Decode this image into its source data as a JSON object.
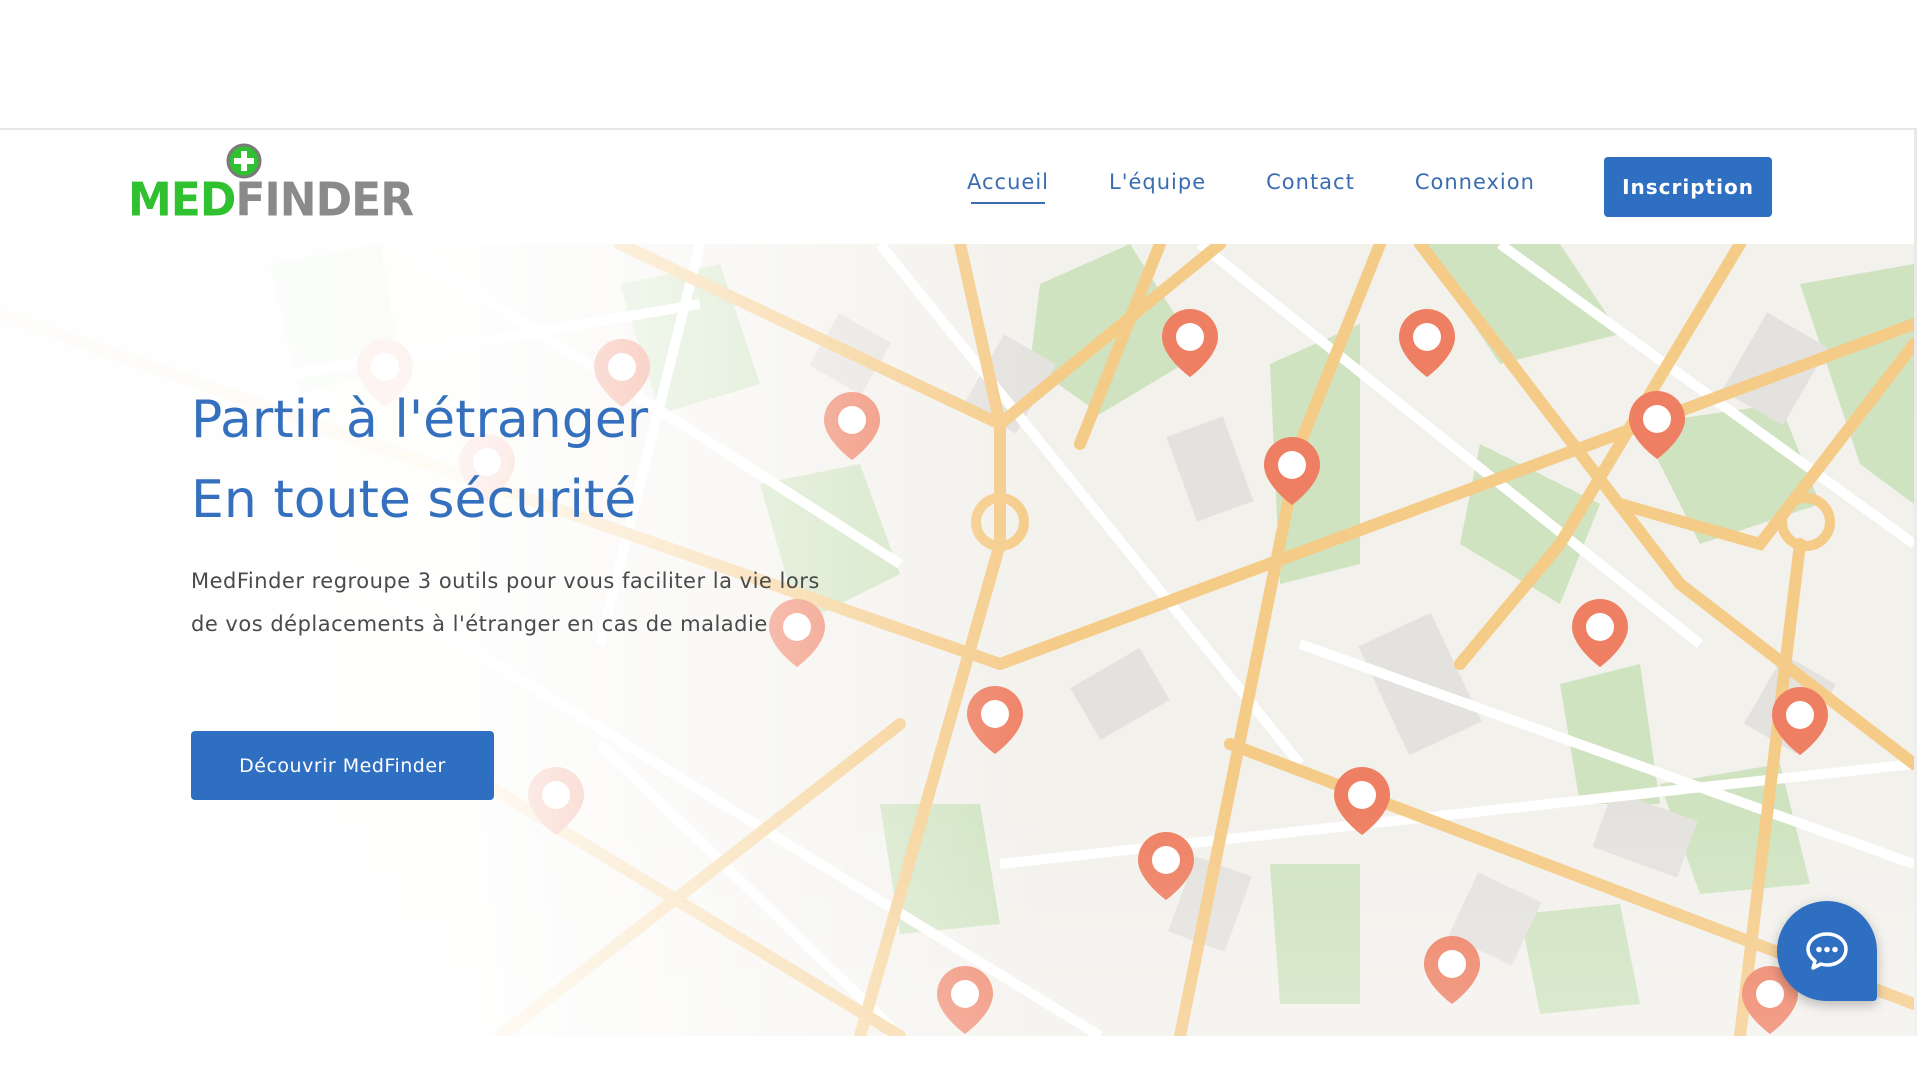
{
  "brand": {
    "logo_med": "MED",
    "logo_finder": "FINDER",
    "colors": {
      "primary": "#2f6fc2",
      "logo_green": "#2fc12f",
      "logo_gray": "#8a8a8a"
    }
  },
  "nav": {
    "items": [
      {
        "label": "Accueil",
        "active": true
      },
      {
        "label": "L'équipe",
        "active": false
      },
      {
        "label": "Contact",
        "active": false
      },
      {
        "label": "Connexion",
        "active": false
      }
    ],
    "signup_label": "Inscription"
  },
  "hero": {
    "title_line1": "Partir à l'étranger",
    "title_line2": "En toute sécurité",
    "description": "MedFinder regroupe 3 outils pour vous faciliter la vie lors de vos déplacements à l'étranger en cas de maladie",
    "cta_label": "Découvrir MedFinder"
  },
  "chat": {
    "icon": "chat-bubble-icon"
  }
}
